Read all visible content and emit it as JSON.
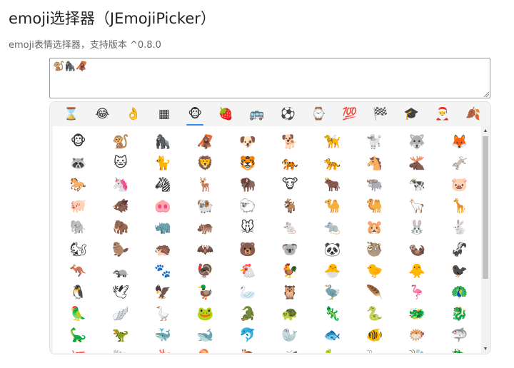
{
  "page": {
    "title": "emoji选择器（JEmojiPicker）",
    "subtitle": "emoji表情选择器，支持版本 ^0.8.0"
  },
  "editor": {
    "value": "🐒🦍🦧"
  },
  "picker": {
    "accent_color": "#2a8ee8",
    "active_tab_index": 4,
    "tabs": [
      {
        "name": "recent-tab",
        "icon": "⌛"
      },
      {
        "name": "smileys-tab",
        "icon": "😂"
      },
      {
        "name": "people-tab",
        "icon": "👌"
      },
      {
        "name": "symbols-grid-tab",
        "icon": "▦"
      },
      {
        "name": "animals-tab",
        "icon": "🐵"
      },
      {
        "name": "food-tab",
        "icon": "🍓"
      },
      {
        "name": "travel-tab",
        "icon": "🚌"
      },
      {
        "name": "activities-tab",
        "icon": "⚽"
      },
      {
        "name": "objects-tab",
        "icon": "⌚"
      },
      {
        "name": "symbols-tab",
        "icon": "💯"
      },
      {
        "name": "flags-tab",
        "icon": "🏁"
      },
      {
        "name": "education-tab",
        "icon": "🎓"
      },
      {
        "name": "santa-tab",
        "icon": "🎅"
      },
      {
        "name": "leaf-tab",
        "icon": "🍂"
      }
    ],
    "emojis": [
      "🐵",
      "🐒",
      "🦍",
      "🦧",
      "🐶",
      "🐕",
      "🦮",
      "🐩",
      "🐺",
      "🦊",
      "🦝",
      "🐱",
      "🐈",
      "🦁",
      "🐯",
      "🐅",
      "🐆",
      "🐴",
      "🫎",
      "🫏",
      "🐎",
      "🦄",
      "🦓",
      "🦌",
      "🦬",
      "🐮",
      "🐂",
      "🐃",
      "🐄",
      "🐷",
      "🐖",
      "🐗",
      "🐽",
      "🐏",
      "🐑",
      "🐐",
      "🐪",
      "🐫",
      "🦙",
      "🦒",
      "🐘",
      "🦣",
      "🦏",
      "🦛",
      "🐭",
      "🐁",
      "🐀",
      "🐹",
      "🐰",
      "🐇",
      "🐿",
      "🦫",
      "🦔",
      "🦇",
      "🐻",
      "🐨",
      "🐼",
      "🦥",
      "🦦",
      "🦨",
      "🦘",
      "🦡",
      "🐾",
      "🦃",
      "🐔",
      "🐓",
      "🐣",
      "🐤",
      "🐥",
      "🐦‍⬛",
      "🐧",
      "🕊",
      "🦅",
      "🦆",
      "🦢",
      "🦉",
      "🦤",
      "🪶",
      "🦩",
      "🦚",
      "🦜",
      "🪽",
      "🪿",
      "🐸",
      "🐊",
      "🐢",
      "🦎",
      "🐍",
      "🐲",
      "🐉",
      "🦕",
      "🦖",
      "🐳",
      "🐋",
      "🐬",
      "🦭",
      "🐟",
      "🐠",
      "🐡",
      "🦈",
      "🐙",
      "🐚",
      "🪸",
      "🪼",
      "🐌",
      "🦋",
      "🐛",
      "🐜",
      "🐝",
      "🪲"
    ]
  }
}
